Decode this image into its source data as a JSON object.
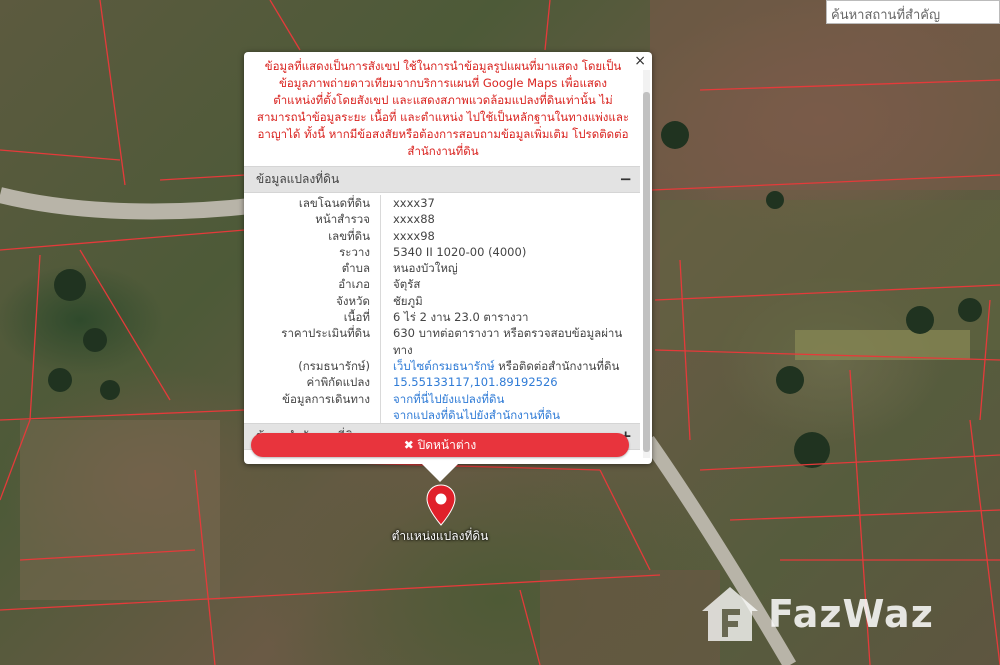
{
  "search": {
    "placeholder": "ค้นหาสถานที่สำคัญ"
  },
  "popup": {
    "close_symbol": "×",
    "disclaimer": "ข้อมูลที่แสดงเป็นการสังเขป ใช้ในการนำข้อมูลรูปแผนที่มาแสดง โดยเป็นข้อมูลภาพถ่ายดาวเทียมจากบริการแผนที่ Google Maps เพื่อแสดงตำแหน่งที่ตั้งโดยสังเขป และแสดงสภาพแวดล้อมแปลงที่ดินเท่านั้น ไม่สามารถนำข้อมูลระยะ เนื้อที่ และตำแหน่ง ไปใช้เป็นหลักฐานในทางแพ่งและอาญาได้ ทั้งนี้ หากมีข้อสงสัยหรือต้องการสอบถามข้อมูลเพิ่มเติม โปรดติดต่อสำนักงานที่ดิน",
    "section1_title": "ข้อมูลแปลงที่ดิน",
    "section1_toggle": "−",
    "rows": [
      {
        "label": "เลขโฉนดที่ดิน",
        "value": "xxxx37"
      },
      {
        "label": "หน้าสำรวจ",
        "value": "xxxx88"
      },
      {
        "label": "เลขที่ดิน",
        "value": "xxxx98"
      },
      {
        "label": "ระวาง",
        "value": "5340 II 1020-00 (4000)"
      },
      {
        "label": "ตำบล",
        "value": "หนองบัวใหญ่"
      },
      {
        "label": "อำเภอ",
        "value": "จัตุรัส"
      },
      {
        "label": "จังหวัด",
        "value": "ชัยภูมิ"
      },
      {
        "label": "เนื้อที่",
        "value": "6 ไร่ 2 งาน 23.0 ตารางวา"
      },
      {
        "label": "ราคาประเมินที่ดิน",
        "value": "630 บาทต่อตารางวา หรือตรวจสอบข้อมูลผ่านทาง"
      },
      {
        "label": "(กรมธนารักษ์)",
        "value_link": "เว็บไซต์กรมธนารักษ์",
        "value_rest": " หรือติดต่อสำนักงานที่ดิน"
      },
      {
        "label": "ค่าพิกัดแปลง",
        "link": "15.55133117,101.89192526"
      },
      {
        "label": "ข้อมูลการเดินทาง",
        "link": "จากที่นี่ไปยังแปลงที่ดิน"
      },
      {
        "label": "",
        "link": "จากแปลงที่ดินไปยังสำนักงานที่ดิน"
      }
    ],
    "section2_title": "ข้อมูลสำนักงานที่ดิน",
    "section2_toggle": "+",
    "close_button": "✖ ปิดหน้าต่าง"
  },
  "marker": {
    "label": "ตำแหน่งแปลงที่ดิน",
    "color": "#e0202a"
  },
  "watermark": {
    "text": "FazWaz"
  },
  "colors": {
    "accent": "#e8343d",
    "link": "#2f7bd6",
    "disclaimer": "#d9231f",
    "parcel_line": "#e53a3a"
  }
}
